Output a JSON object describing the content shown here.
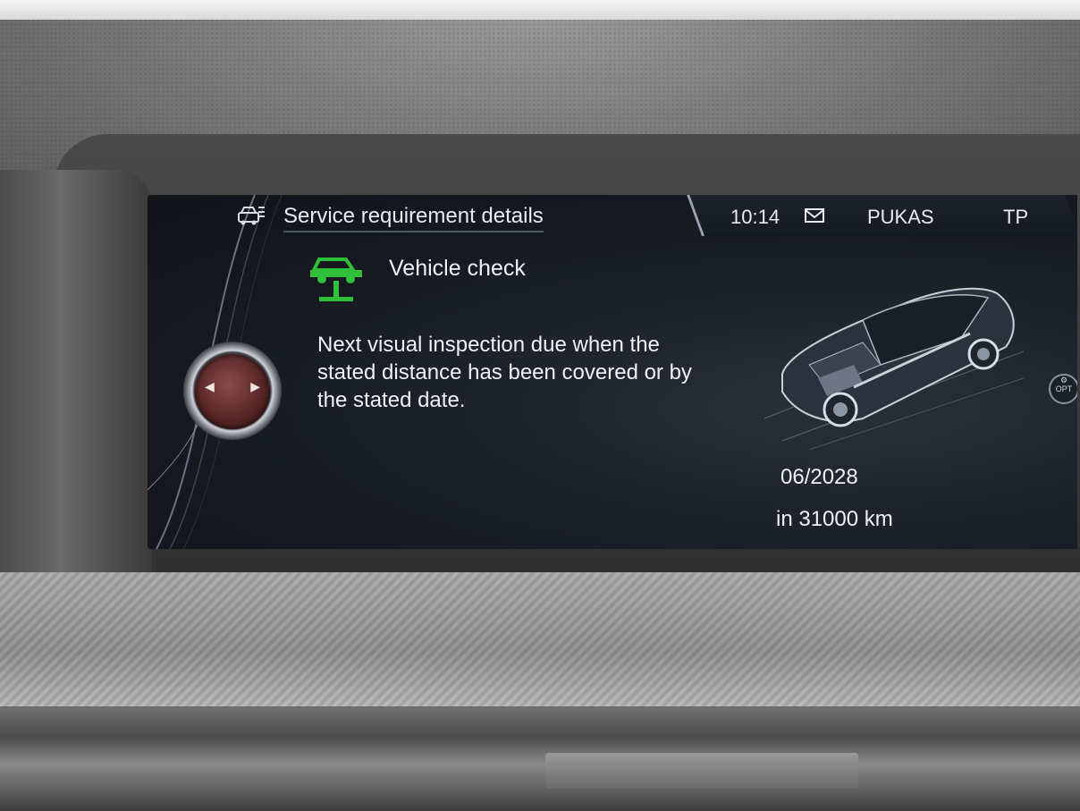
{
  "header": {
    "title": "Service requirement details",
    "icon": "service-car-list-icon"
  },
  "status_bar": {
    "time": "10:14",
    "mail_icon": "envelope-icon",
    "station": "PUKAS",
    "traffic_program": "TP"
  },
  "service_item": {
    "icon": "vehicle-lift-icon",
    "icon_color": "#2fbf3a",
    "title": "Vehicle check",
    "description": "Next visual inspection due when the stated distance has been covered or by the stated date.",
    "due_date": "06/2028",
    "due_distance": "in 31000 km"
  },
  "option_button": {
    "icon": "options-gear-icon",
    "label": "OPT"
  },
  "controller": {
    "icon": "left-right-arrows-icon"
  }
}
